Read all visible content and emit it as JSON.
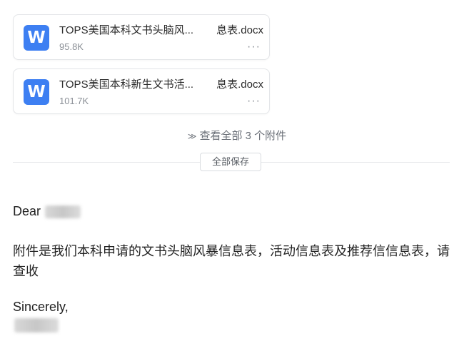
{
  "attachments": [
    {
      "icon": "word-icon",
      "icon_letter": "W",
      "name_start": "TOPS美国本科文书头脑风...",
      "name_end": "息表.docx",
      "size": "95.8K",
      "more": "···"
    },
    {
      "icon": "word-icon",
      "icon_letter": "W",
      "name_start": "TOPS美国本科新生文书活...",
      "name_end": "息表.docx",
      "size": "101.7K",
      "more": "···"
    }
  ],
  "view_all": {
    "chevron": "≫",
    "label": "查看全部 3 个附件"
  },
  "save_all_label": "全部保存",
  "message": {
    "greeting": "Dear",
    "paragraph": "附件是我们本科申请的文书头脑风暴信息表，活动信息表及推荐信信息表，请查收",
    "closing": "Sincerely,"
  },
  "colors": {
    "word_icon": "#3d7ff2",
    "muted_text": "#8a8f96"
  }
}
